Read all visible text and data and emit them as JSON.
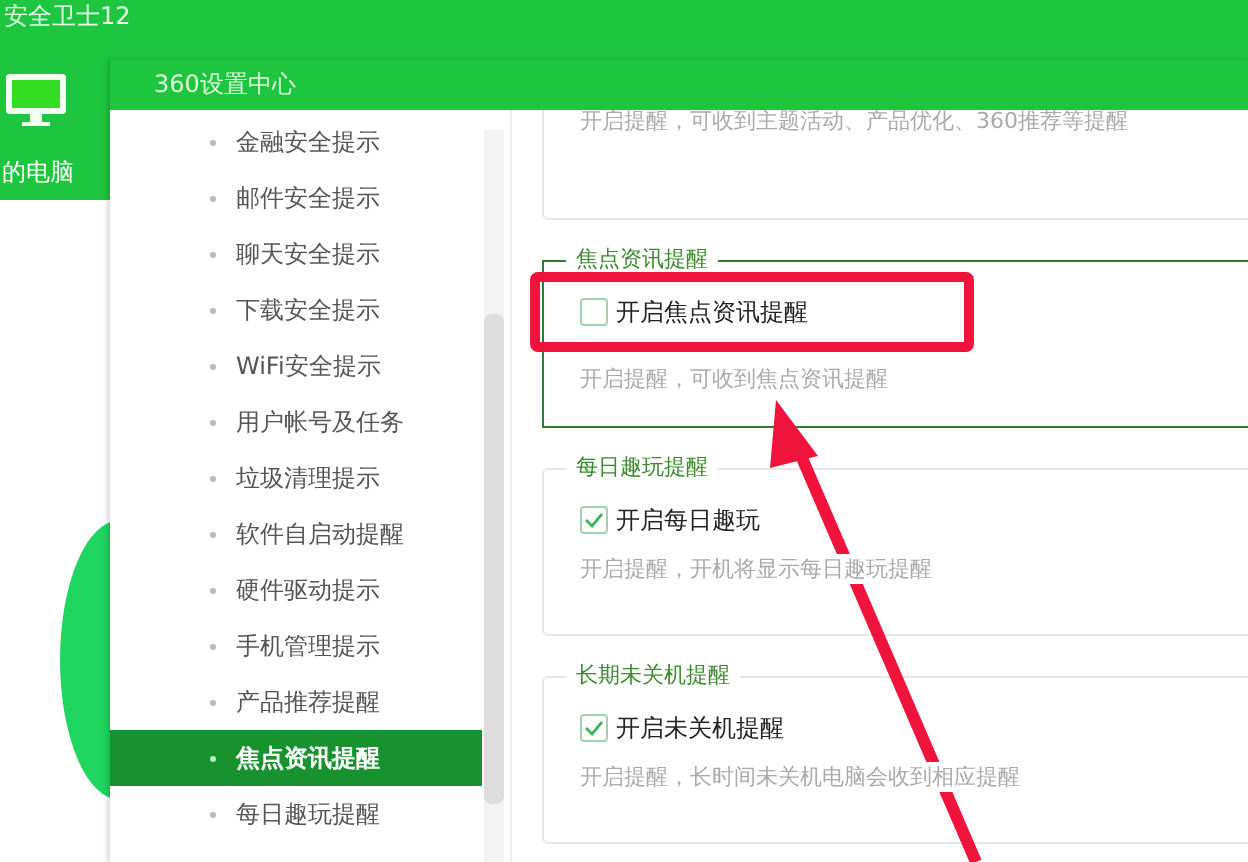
{
  "app": {
    "title": "安全卫士12",
    "nav_label": "的电脑"
  },
  "dialog": {
    "title": "360设置中心",
    "sidebar": {
      "items": [
        {
          "label": "金融安全提示",
          "selected": false
        },
        {
          "label": "邮件安全提示",
          "selected": false
        },
        {
          "label": "聊天安全提示",
          "selected": false
        },
        {
          "label": "下载安全提示",
          "selected": false
        },
        {
          "label": "WiFi安全提示",
          "selected": false
        },
        {
          "label": "用户帐号及任务",
          "selected": false
        },
        {
          "label": "垃圾清理提示",
          "selected": false
        },
        {
          "label": "软件自启动提醒",
          "selected": false
        },
        {
          "label": "硬件驱动提示",
          "selected": false
        },
        {
          "label": "手机管理提示",
          "selected": false
        },
        {
          "label": "产品推荐提醒",
          "selected": false
        },
        {
          "label": "焦点资讯提醒",
          "selected": true
        },
        {
          "label": "每日趣玩提醒",
          "selected": false
        }
      ]
    },
    "sections": [
      {
        "focused": false,
        "description": "开启提醒，可收到主题活动、产品优化、360推荐等提醒"
      },
      {
        "title": "焦点资讯提醒",
        "checked": false,
        "focused": true,
        "option": "开启焦点资讯提醒",
        "description": "开启提醒，可收到焦点资讯提醒"
      },
      {
        "title": "每日趣玩提醒",
        "checked": true,
        "focused": false,
        "option": "开启每日趣玩",
        "description": "开启提醒，开机将显示每日趣玩提醒"
      },
      {
        "title": "长期未关机提醒",
        "checked": true,
        "focused": false,
        "option": "开启未关机提醒",
        "description": "开启提醒，长时间未关机电脑会收到相应提醒"
      }
    ]
  },
  "annotations": {
    "highlight_box": true,
    "arrow": true
  }
}
